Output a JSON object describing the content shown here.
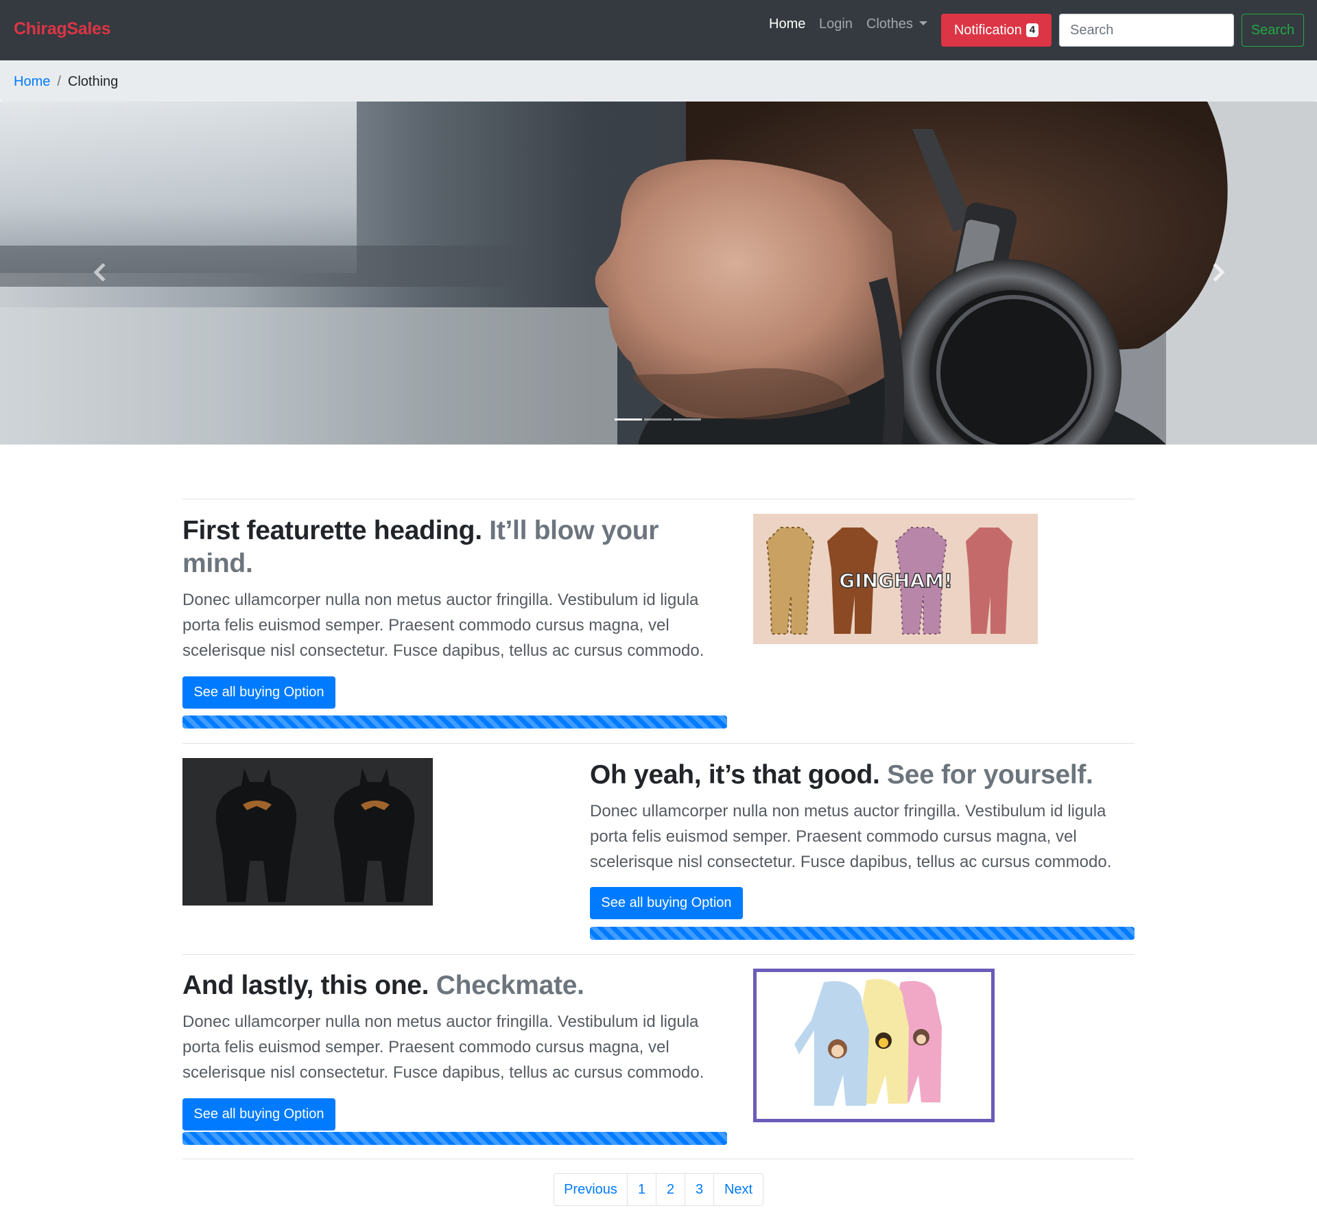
{
  "navbar": {
    "brand": "ChiragSales",
    "links": {
      "home": "Home",
      "login": "Login",
      "clothes": "Clothes"
    },
    "notification": {
      "label": "Notification",
      "count": "4"
    },
    "search": {
      "placeholder": "Search",
      "value": "",
      "button_label": "Search"
    }
  },
  "breadcrumb": {
    "home": "Home",
    "separator": "/",
    "current": "Clothing"
  },
  "carousel": {
    "slide_count": 3,
    "active_slide": 1
  },
  "featurettes": [
    {
      "heading": "First featurette heading.",
      "heading_muted": "It’ll blow your mind.",
      "text": "Donec ullamcorper nulla non metus auctor fringilla. Vestibulum id ligula porta felis euismod semper. Praesent commodo cursus magna, vel scelerisque nisl consectetur. Fusce dapibus, tellus ac cursus commodo.",
      "button_label": "See all buying Option",
      "image_text": "GINGHAM!",
      "progress": 1.0
    },
    {
      "heading": "Oh yeah, it’s that good.",
      "heading_muted": "See for yourself.",
      "text": "Donec ullamcorper nulla non metus auctor fringilla. Vestibulum id ligula porta felis euismod semper. Praesent commodo cursus magna, vel scelerisque nisl consectetur. Fusce dapibus, tellus ac cursus commodo.",
      "button_label": "See all buying Option",
      "progress": 1.0
    },
    {
      "heading": "And lastly, this one.",
      "heading_muted": "Checkmate.",
      "text": "Donec ullamcorper nulla non metus auctor fringilla. Vestibulum id ligula porta felis euismod semper. Praesent commodo cursus magna, vel scelerisque nisl consectetur. Fusce dapibus, tellus ac cursus commodo.",
      "button_label": "See all buying Option",
      "progress": 1.0
    }
  ],
  "pagination": {
    "previous": "Previous",
    "pages": [
      "1",
      "2",
      "3"
    ],
    "next": "Next"
  },
  "colors": {
    "navbar_bg": "#343a40",
    "brand": "#dc3545",
    "primary": "#007bff",
    "danger": "#dc3545",
    "success": "#28a745",
    "muted": "#6c757d",
    "breadcrumb_bg": "#e9ecef",
    "image_frame": "#6a5cb8"
  },
  "icons": [
    "chevron-left-icon",
    "chevron-right-icon",
    "caret-down-icon"
  ]
}
